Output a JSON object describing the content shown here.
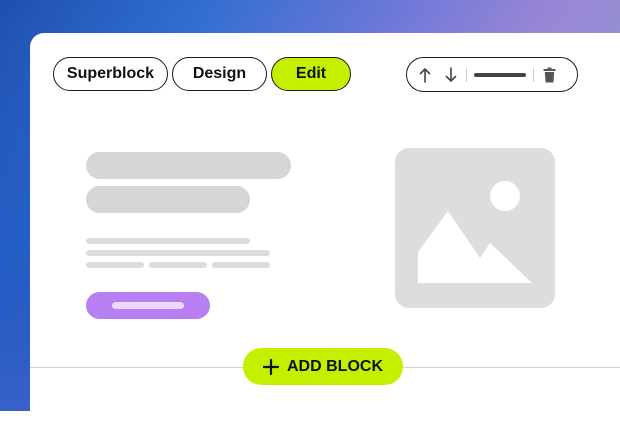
{
  "tabs": [
    {
      "label": "Superblock",
      "active": false
    },
    {
      "label": "Design",
      "active": false
    },
    {
      "label": "Edit",
      "active": true
    }
  ],
  "toolbar": {
    "icons": [
      "arrow-up-icon",
      "arrow-down-icon",
      "drag-handle",
      "trash-icon"
    ]
  },
  "add_block": {
    "label": "ADD BLOCK",
    "icon": "plus-icon"
  },
  "colors": {
    "accent_lime": "#c4f000",
    "button_purple": "#b77ff2",
    "placeholder_gray": "#d6d6d6",
    "border_dark": "#1a1a1a"
  }
}
